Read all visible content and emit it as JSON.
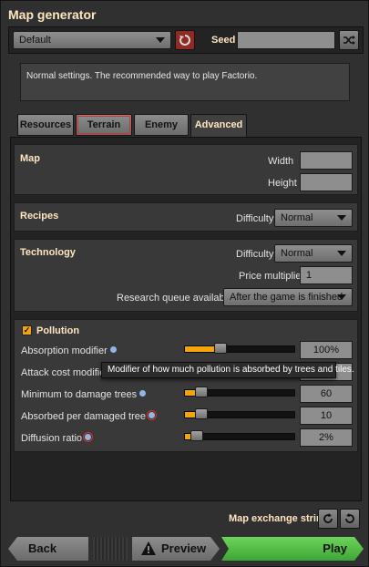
{
  "window": {
    "title": "Map generator"
  },
  "preset": {
    "value": "Default"
  },
  "seed": {
    "label": "Seed",
    "value": ""
  },
  "description": "Normal settings. The recommended way to play Factorio.",
  "tabs": [
    {
      "label": "Resources"
    },
    {
      "label": "Terrain"
    },
    {
      "label": "Enemy"
    },
    {
      "label": "Advanced"
    }
  ],
  "map": {
    "heading": "Map",
    "width_label": "Width",
    "width_value": "",
    "height_label": "Height",
    "height_value": ""
  },
  "recipes": {
    "heading": "Recipes",
    "difficulty_label": "Difficulty",
    "difficulty_value": "Normal"
  },
  "technology": {
    "heading": "Technology",
    "difficulty_label": "Difficulty",
    "difficulty_value": "Normal",
    "price_label": "Price multiplier",
    "price_value": "1",
    "queue_label": "Research queue availability",
    "queue_value": "After the game is finished"
  },
  "pollution": {
    "heading": "Pollution",
    "enabled": true,
    "rows": [
      {
        "label": "Absorption modifier",
        "value": "100%",
        "level": 0.3
      },
      {
        "label": "Attack cost modifier",
        "value": "",
        "level": 0.0
      },
      {
        "label": "Minimum to damage trees",
        "value": "60",
        "level": 0.1
      },
      {
        "label": "Absorbed per damaged tree",
        "value": "10",
        "level": 0.1
      },
      {
        "label": "Diffusion ratio",
        "value": "2%",
        "level": 0.06
      }
    ],
    "tooltip": "Modifier of how much pollution is absorbed by trees and tiles."
  },
  "exchange": {
    "label": "Map exchange string"
  },
  "buttons": {
    "back": "Back",
    "preview": "Preview",
    "play": "Play"
  },
  "colors": {
    "accent": "#f2a60a",
    "play": "#5ec24e",
    "heading": "#ffe6c0"
  },
  "icons": {
    "reset": "reset-icon",
    "shuffle": "shuffle-icon",
    "warning": "warning-icon",
    "import": "import-icon",
    "export": "export-icon"
  }
}
